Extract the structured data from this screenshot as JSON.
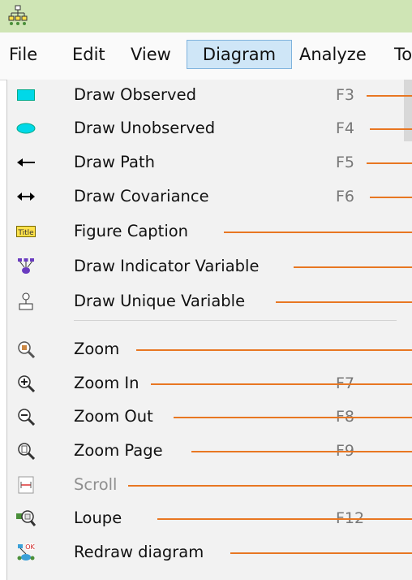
{
  "menubar": {
    "items": [
      "File",
      "Edit",
      "View",
      "Diagram",
      "Analyze",
      "To"
    ],
    "active": "Diagram"
  },
  "diagram_menu": {
    "items": [
      {
        "label": "Draw Observed",
        "shortcut": "F3",
        "icon": "rectangle-icon"
      },
      {
        "label": "Draw Unobserved",
        "shortcut": "F4",
        "icon": "ellipse-icon"
      },
      {
        "label": "Draw Path",
        "shortcut": "F5",
        "icon": "arrow-left-icon"
      },
      {
        "label": "Draw Covariance",
        "shortcut": "F6",
        "icon": "double-arrow-icon"
      },
      {
        "label": "Figure Caption",
        "shortcut": "",
        "icon": "title-icon"
      },
      {
        "label": "Draw Indicator Variable",
        "shortcut": "",
        "icon": "indicator-variable-icon"
      },
      {
        "label": "Draw Unique Variable",
        "shortcut": "",
        "icon": "unique-variable-icon"
      },
      {
        "label": "Zoom",
        "shortcut": "",
        "icon": "zoom-icon"
      },
      {
        "label": "Zoom In",
        "shortcut": "F7",
        "icon": "zoom-in-icon"
      },
      {
        "label": "Zoom Out",
        "shortcut": "F8",
        "icon": "zoom-out-icon"
      },
      {
        "label": "Zoom Page",
        "shortcut": "F9",
        "icon": "zoom-page-icon"
      },
      {
        "label": "Scroll",
        "shortcut": "",
        "icon": "scroll-icon",
        "disabled": true
      },
      {
        "label": "Loupe",
        "shortcut": "F12",
        "icon": "loupe-icon"
      },
      {
        "label": "Redraw diagram",
        "shortcut": "",
        "icon": "redraw-diagram-icon"
      }
    ]
  },
  "colors": {
    "accent": "#e87722",
    "titlebar": "#cfe5b5",
    "menu_highlight": "#cfe6f7",
    "shape_fill": "#00d8e8"
  }
}
